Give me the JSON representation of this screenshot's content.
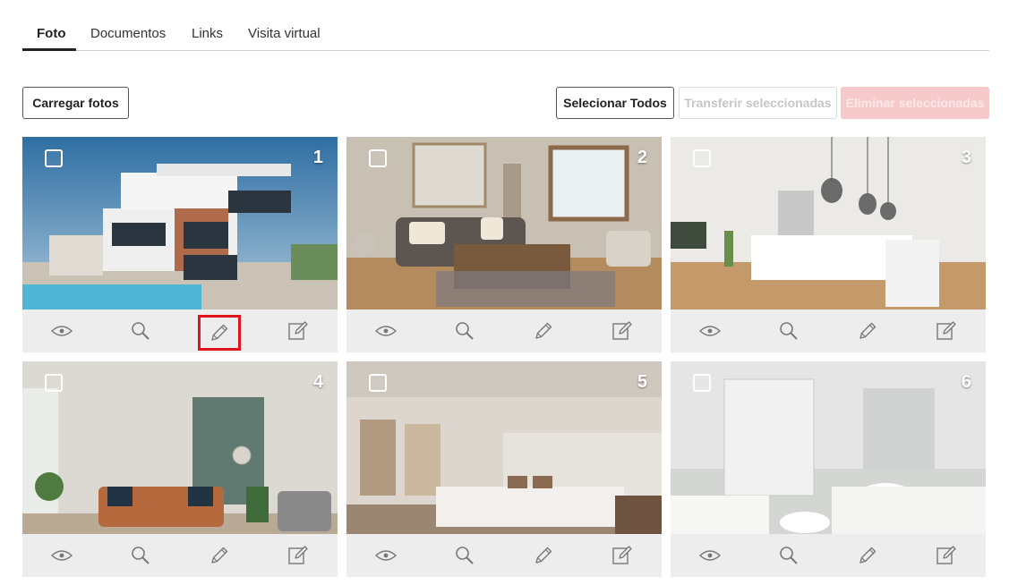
{
  "tabs": [
    {
      "label": "Foto",
      "active": true
    },
    {
      "label": "Documentos",
      "active": false
    },
    {
      "label": "Links",
      "active": false
    },
    {
      "label": "Visita virtual",
      "active": false
    }
  ],
  "toolbar": {
    "upload_label": "Carregar fotos",
    "select_all_label": "Selecionar Todos",
    "transfer_label": "Transferir seleccionadas",
    "delete_label": "Eliminar seleccionadas"
  },
  "photos": [
    {
      "number": "1",
      "scene": "house exterior with pool"
    },
    {
      "number": "2",
      "scene": "living room"
    },
    {
      "number": "3",
      "scene": "kitchen"
    },
    {
      "number": "4",
      "scene": "living room"
    },
    {
      "number": "5",
      "scene": "bedroom"
    },
    {
      "number": "6",
      "scene": "bathroom"
    }
  ],
  "actions": [
    "view-icon",
    "zoom-icon",
    "pencil-icon",
    "edit-note-icon"
  ],
  "colors": {
    "highlight": "#e0141c",
    "action_bar": "#ededed",
    "delete_button": "#f6caca"
  }
}
